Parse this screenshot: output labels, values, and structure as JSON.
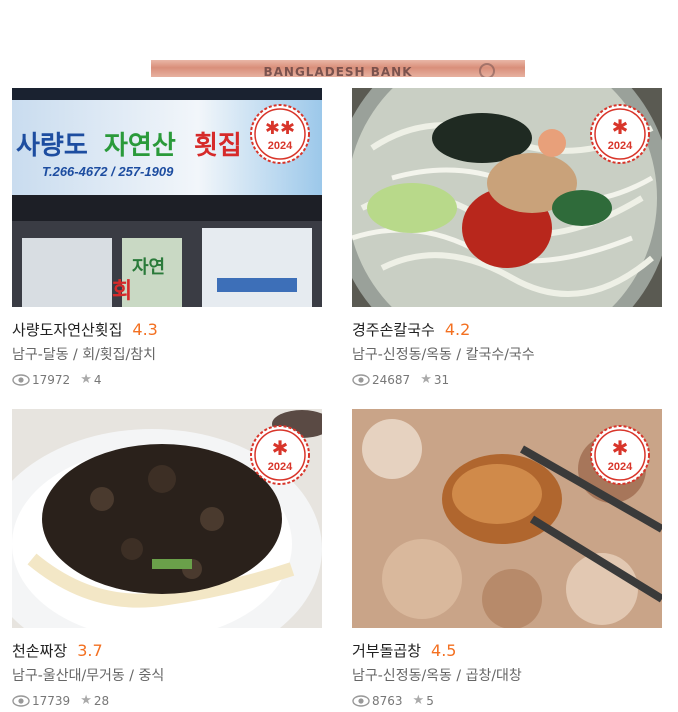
{
  "banner": {
    "text": "BANGLADESH BANK"
  },
  "restaurants": [
    {
      "name": "사량도자연산횟집",
      "rating": "4.3",
      "location": "남구-달동",
      "category": "회/횟집/참치",
      "views": "17972",
      "favorites": "4",
      "badge_year": "2024",
      "badge_marks": 2,
      "photo": "restaurant-storefront",
      "sign_text": "사량도 자연산 횟집",
      "sign_phone": "T.266-4672 / 257-1909"
    },
    {
      "name": "경주손칼국수",
      "rating": "4.2",
      "location": "남구-신정동/옥동",
      "category": "칼국수/국수",
      "views": "24687",
      "favorites": "31",
      "badge_year": "2024",
      "badge_marks": 1,
      "photo": "kalguksu-noodle-soup"
    },
    {
      "name": "천손짜장",
      "rating": "3.7",
      "location": "남구-울산대/무거동",
      "category": "중식",
      "views": "17739",
      "favorites": "28",
      "badge_year": "2024",
      "badge_marks": 1,
      "photo": "jajangmyeon"
    },
    {
      "name": "거부돌곱창",
      "rating": "4.5",
      "location": "남구-신정동/옥동",
      "category": "곱창/대창",
      "views": "8763",
      "favorites": "5",
      "badge_year": "2024",
      "badge_marks": 1,
      "photo": "grilled-gopchang"
    }
  ],
  "separator": " / ",
  "colors": {
    "rating": "#f37021",
    "badge": "#d8352a"
  }
}
